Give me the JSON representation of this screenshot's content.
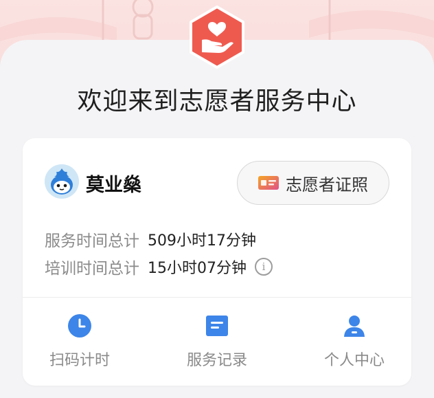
{
  "page": {
    "welcome_title": "欢迎来到志愿者服务中心"
  },
  "user": {
    "name": "莫业燊"
  },
  "certificate_button": {
    "label": "志愿者证照"
  },
  "stats": {
    "service_time_label": "服务时间总计",
    "service_time_value": "509小时17分钟",
    "training_time_label": "培训时间总计",
    "training_time_value": "15小时07分钟",
    "info_glyph": "i"
  },
  "nav": [
    {
      "label": "扫码计时",
      "icon": "clock-icon"
    },
    {
      "label": "服务记录",
      "icon": "record-icon"
    },
    {
      "label": "个人中心",
      "icon": "person-icon"
    }
  ],
  "colors": {
    "brand_red": "#ef5a4f",
    "accent_blue": "#3d85e8",
    "header_pink": "#fbe3e1"
  }
}
